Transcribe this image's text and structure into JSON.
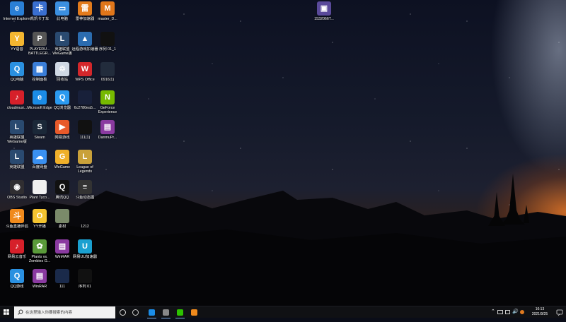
{
  "desktop": {
    "icons": [
      {
        "label": "Internet Explorer",
        "icon": "ie-icon",
        "color": "#2a7fd6",
        "glyph": "e"
      },
      {
        "label": "凯凯卡丁车",
        "icon": "game-icon",
        "color": "#3a6fd0",
        "glyph": "卡"
      },
      {
        "label": "此电脑",
        "icon": "computer-icon",
        "color": "#3b8fe0",
        "glyph": "▭"
      },
      {
        "label": "雷神加速器",
        "icon": "accelerator-icon",
        "color": "#e37b1c",
        "glyph": "雷"
      },
      {
        "label": "master_D...",
        "icon": "app-icon",
        "color": "#e0761a",
        "glyph": "M"
      },
      {
        "label": "YY语音",
        "icon": "yy-icon",
        "color": "#f4b630",
        "glyph": "Y"
      },
      {
        "label": "PLAYERU... BATTLEGR...",
        "icon": "pubg-icon",
        "color": "#555",
        "glyph": "P"
      },
      {
        "label": "英雄联盟WeGame版",
        "icon": "lol-icon",
        "color": "#2a4a70",
        "glyph": "L"
      },
      {
        "label": "远程游戏加速器",
        "icon": "remote-game-icon",
        "color": "#2b6cb0",
        "glyph": "▲"
      },
      {
        "label": "序列 01_1",
        "icon": "video-file-icon",
        "color": "#111",
        "glyph": ""
      },
      {
        "label": "QQ电脑",
        "icon": "qq-pc-icon",
        "color": "#2a90e0",
        "glyph": "Q"
      },
      {
        "label": "控制面板",
        "icon": "control-panel-icon",
        "color": "#3a7ed8",
        "glyph": "▦"
      },
      {
        "label": "回收站",
        "icon": "recycle-bin-icon",
        "color": "#cfd8e4",
        "glyph": "♲"
      },
      {
        "label": "WPS Office",
        "icon": "wps-icon",
        "color": "#d3272b",
        "glyph": "W"
      },
      {
        "label": "0916(1)",
        "icon": "image-file-icon",
        "color": "#222c3c",
        "glyph": ""
      },
      {
        "label": "cloudmusi...",
        "icon": "netease-music-icon",
        "color": "#d6202a",
        "glyph": "♪"
      },
      {
        "label": "Microsoft Edge",
        "icon": "edge-icon",
        "color": "#1b8ce6",
        "glyph": "e"
      },
      {
        "label": "QQ浏览器",
        "icon": "qq-browser-icon",
        "color": "#2a9af0",
        "glyph": "Q"
      },
      {
        "label": "6c2780ea5...",
        "icon": "image-file-icon",
        "color": "#18203a",
        "glyph": ""
      },
      {
        "label": "GeForce Experience",
        "icon": "nvidia-icon",
        "color": "#76b900",
        "glyph": "N"
      },
      {
        "label": "英雄联盟WeGame版",
        "icon": "lol-icon",
        "color": "#2a4a70",
        "glyph": "L"
      },
      {
        "label": "Steam",
        "icon": "steam-icon",
        "color": "#1b2838",
        "glyph": "S"
      },
      {
        "label": "网易游戏",
        "icon": "netease-game-icon",
        "color": "#e85a2a",
        "glyph": "▶"
      },
      {
        "label": "111(1)",
        "icon": "video-file-icon",
        "color": "#111",
        "glyph": ""
      },
      {
        "label": "DanmuPr...",
        "icon": "winrar-icon",
        "color": "#8a3aa0",
        "glyph": "▤"
      },
      {
        "label": "英雄联盟",
        "icon": "lol-icon",
        "color": "#2a4a70",
        "glyph": "L"
      },
      {
        "label": "百度网盘",
        "icon": "baidu-netdisk-icon",
        "color": "#3a90f0",
        "glyph": "☁"
      },
      {
        "label": "WeGame",
        "icon": "wegame-icon",
        "color": "#f0b02a",
        "glyph": "G"
      },
      {
        "label": "League of Legends",
        "icon": "lol-icon",
        "color": "#c9a13a",
        "glyph": "L"
      },
      {
        "label": "OBS Studio",
        "icon": "obs-icon",
        "color": "#302e31",
        "glyph": "◉"
      },
      {
        "label": "Plant Tyco...",
        "icon": "document-icon",
        "color": "#f0f0f0",
        "glyph": ""
      },
      {
        "label": "腾讯QQ",
        "icon": "qq-icon",
        "color": "#111",
        "glyph": "Q"
      },
      {
        "label": "斗鱼动态图",
        "icon": "document-icon",
        "color": "#333",
        "glyph": "≡"
      },
      {
        "label": "斗鱼直播伴侣",
        "icon": "douyu-icon",
        "color": "#f08a1c",
        "glyph": "斗"
      },
      {
        "label": "YY开播",
        "icon": "yy-live-icon",
        "color": "#f4c430",
        "glyph": "O"
      },
      {
        "label": "素材",
        "icon": "folder-icon",
        "color": "#7a8a6a",
        "glyph": ""
      },
      {
        "label": "1212",
        "icon": "file-icon",
        "color": "transparent",
        "glyph": ""
      },
      {
        "label": "网易云音乐",
        "icon": "netease-music-icon",
        "color": "#d6202a",
        "glyph": "♪"
      },
      {
        "label": "Plants vs. Zombies G...",
        "icon": "pvz-icon",
        "color": "#5a9a3a",
        "glyph": "✿"
      },
      {
        "label": "WinRAR",
        "icon": "winrar-icon",
        "color": "#8a3aa0",
        "glyph": "▤"
      },
      {
        "label": "网易UU加速器",
        "icon": "uu-accelerator-icon",
        "color": "#1aa0d0",
        "glyph": "U"
      },
      {
        "label": "QQ游戏",
        "icon": "qq-game-icon",
        "color": "#2a90e0",
        "glyph": "Q"
      },
      {
        "label": "WinRAR",
        "icon": "winrar-icon",
        "color": "#8a3aa0",
        "glyph": "▤"
      },
      {
        "label": "111",
        "icon": "video-file-icon",
        "color": "#1a2a4a",
        "glyph": ""
      },
      {
        "label": "序列 01",
        "icon": "video-file-icon",
        "color": "#111",
        "glyph": ""
      },
      {
        "label": "1532066T...",
        "icon": "image-file-icon",
        "color": "#5a4a9a",
        "glyph": "▣"
      }
    ]
  },
  "taskbar": {
    "search_placeholder": "在这里输入你要搜索的内容",
    "apps": [
      {
        "name": "cortana",
        "color": "#dddddd"
      },
      {
        "name": "task-view",
        "color": "#cccccc"
      },
      {
        "name": "edge",
        "color": "#1b8ce6"
      },
      {
        "name": "obs",
        "color": "#888888"
      },
      {
        "name": "wechat",
        "color": "#2dc100"
      },
      {
        "name": "douyu",
        "color": "#f08a1c"
      }
    ],
    "time": "16:13",
    "date": "2021/9/25",
    "accent": "#7aa8e0"
  }
}
